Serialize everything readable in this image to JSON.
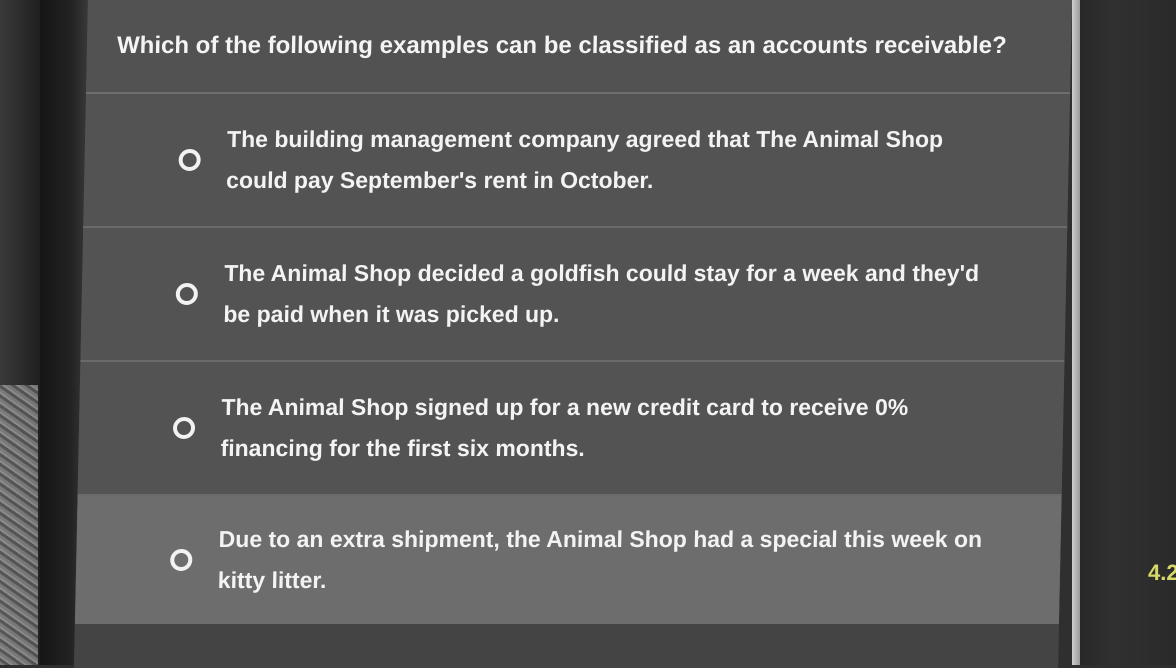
{
  "quiz": {
    "question": "Which of the following examples can be classified as an accounts receivable?",
    "options": [
      {
        "label": "The building management company agreed that The Animal Shop could pay September's rent in October."
      },
      {
        "label": "The Animal Shop decided a goldfish could stay for a week and they'd be paid when it was picked up."
      },
      {
        "label": "The Animal Shop signed up for a new credit card to receive 0% financing for the first six months."
      },
      {
        "label": "Due to an extra shipment, the Animal Shop had a special this week on kitty litter."
      }
    ]
  },
  "side_text": "4.2",
  "colors": {
    "panel_background": "#505050",
    "selected_option_background": "#6d6d6d",
    "text": "#f3f3f3",
    "side_text": "#d6d86a"
  }
}
